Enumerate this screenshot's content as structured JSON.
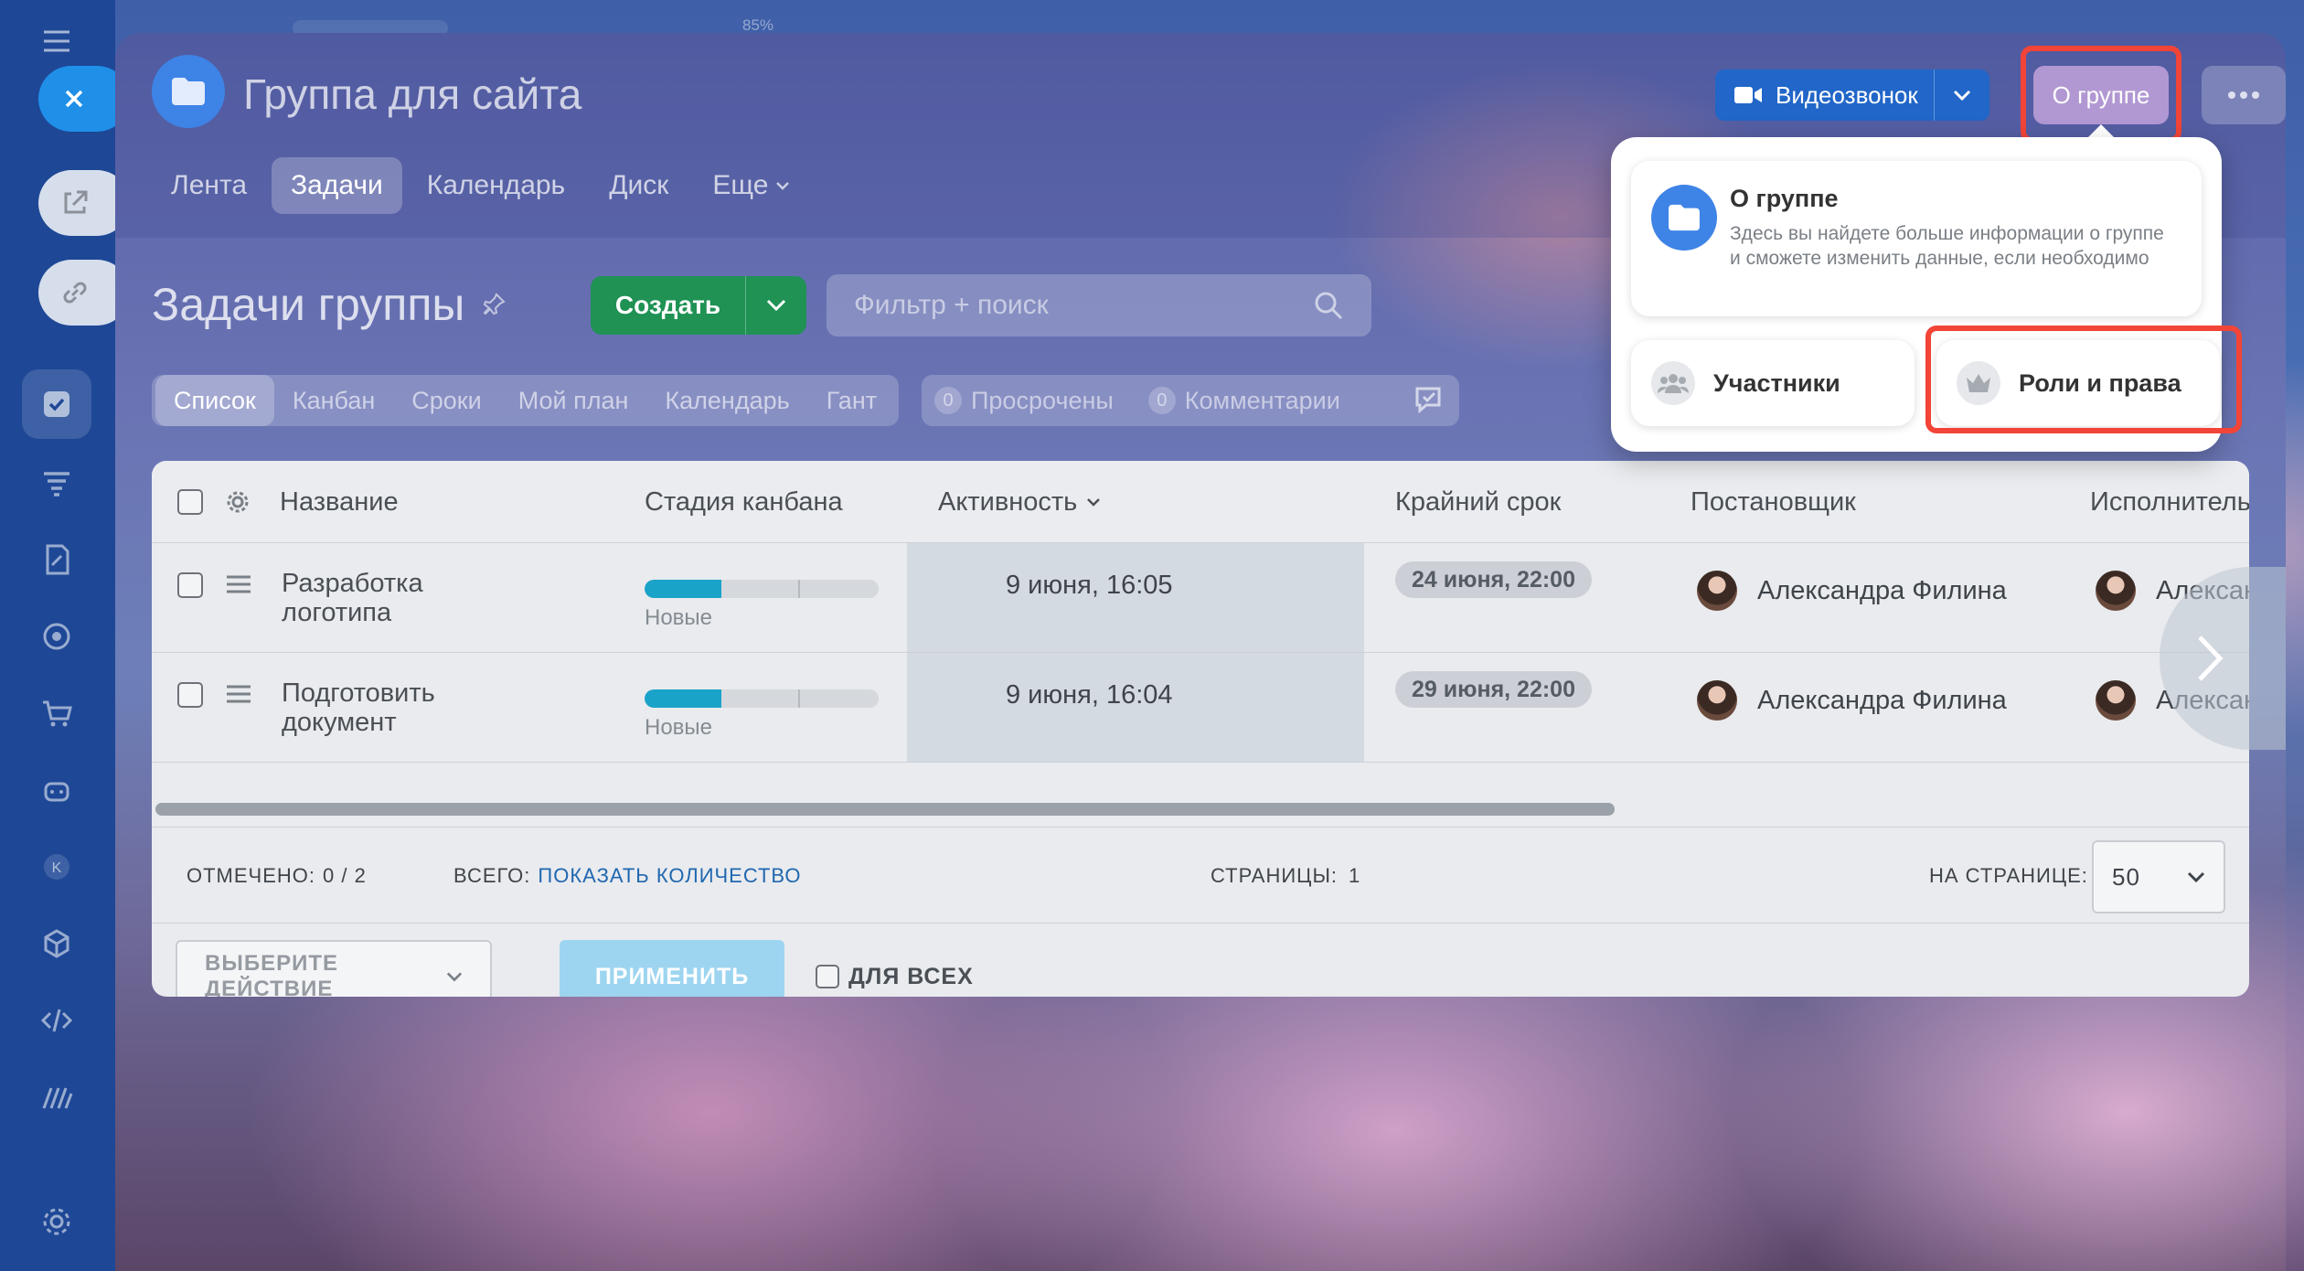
{
  "overlay": {
    "zoom_hint": "85%"
  },
  "group": {
    "title": "Группа для сайта"
  },
  "header": {
    "video_label": "Видеозвонок",
    "about_label": "О группе"
  },
  "nav_tabs": [
    {
      "label": "Лента",
      "active": false
    },
    {
      "label": "Задачи",
      "active": true
    },
    {
      "label": "Календарь",
      "active": false
    },
    {
      "label": "Диск",
      "active": false
    },
    {
      "label": "Еще",
      "active": false
    }
  ],
  "tasks": {
    "title": "Задачи группы",
    "create_label": "Создать",
    "filter_placeholder": "Фильтр + поиск",
    "views": [
      {
        "label": "Список",
        "active": true
      },
      {
        "label": "Канбан",
        "active": false
      },
      {
        "label": "Сроки",
        "active": false
      },
      {
        "label": "Мой план",
        "active": false
      },
      {
        "label": "Календарь",
        "active": false
      },
      {
        "label": "Гант",
        "active": false
      }
    ],
    "counters": [
      {
        "count": "0",
        "label": "Просрочены"
      },
      {
        "count": "0",
        "label": "Комментарии"
      }
    ]
  },
  "grid": {
    "columns": {
      "name": "Название",
      "stage": "Стадия канбана",
      "activity": "Активность",
      "deadline": "Крайний срок",
      "creator": "Постановщик",
      "responsible": "Исполнитель"
    },
    "rows": [
      {
        "name": "Разработка логотипа",
        "stage": "Новые",
        "stage_progress": 0.33,
        "activity": "9 июня, 16:05",
        "deadline": "24 июня, 22:00",
        "creator": "Александра Филина",
        "responsible": "Александра Филина"
      },
      {
        "name": "Подготовить документ",
        "stage": "Новые",
        "stage_progress": 0.33,
        "activity": "9 июня, 16:04",
        "deadline": "29 июня, 22:00",
        "creator": "Александра Филина",
        "responsible": "Александра Филина"
      }
    ],
    "footer": {
      "checked_label": "ОТМЕЧЕНО:",
      "checked_value": "0 / 2",
      "total_label": "ВСЕГО:",
      "total_link": "ПОКАЗАТЬ КОЛИЧЕСТВО",
      "pages_label": "СТРАНИЦЫ:",
      "pages_value": "1",
      "per_page_label": "НА СТРАНИЦЕ:",
      "per_page_value": "50"
    },
    "actions": {
      "select_label": "ВЫБЕРИТЕ ДЕЙСТВИЕ",
      "apply_label": "ПРИМЕНИТЬ",
      "for_all_label": "ДЛЯ ВСЕХ"
    }
  },
  "popup": {
    "about_title": "О группе",
    "about_desc": "Здесь вы найдете больше информации о группе и сможете изменить данные, если необходимо",
    "members_label": "Участники",
    "roles_label": "Роли и права"
  },
  "colors": {
    "highlight": "#f24437",
    "create_green": "#1f9254",
    "video_blue": "#2166c8",
    "kanban_fill": "#1aa3c9",
    "link_blue": "#2067b0"
  }
}
